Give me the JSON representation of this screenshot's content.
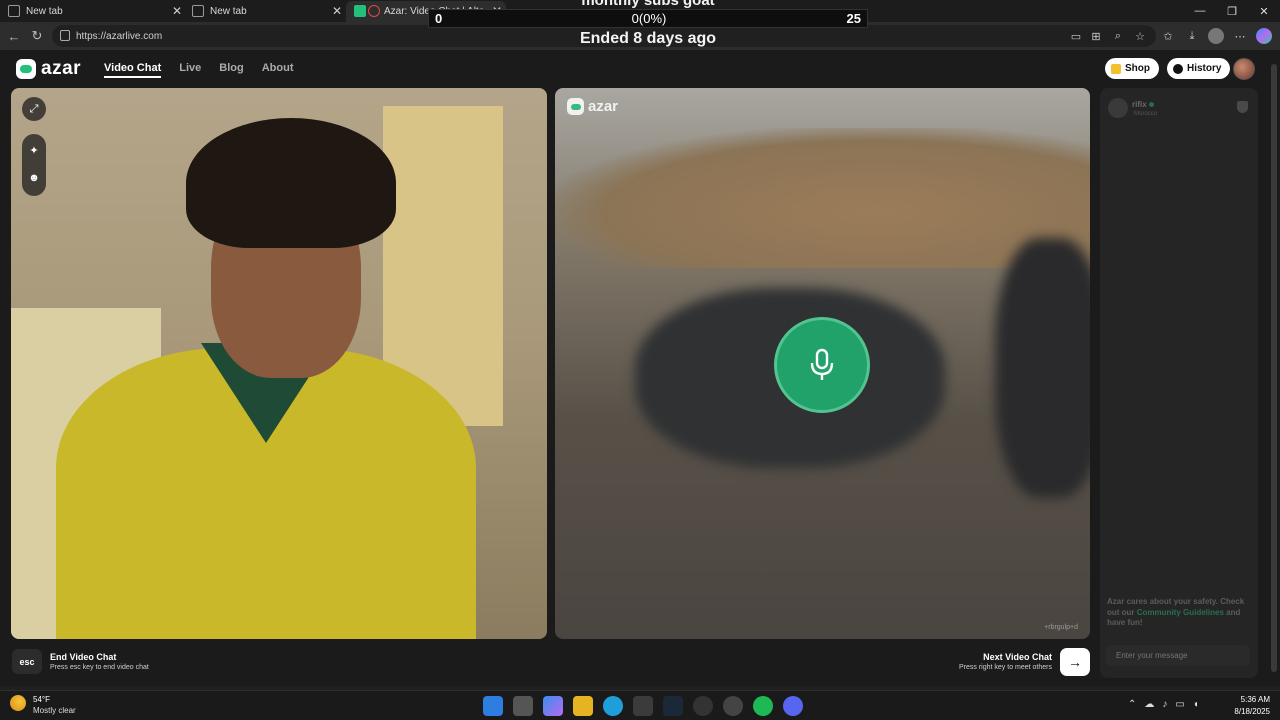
{
  "browser": {
    "tabs": [
      {
        "label": "New tab",
        "active": false
      },
      {
        "label": "New tab",
        "active": false
      },
      {
        "label": "Azar: Video Chat | Alternativ",
        "active": true
      }
    ],
    "url": "https://azarlive.com"
  },
  "overlay": {
    "title": "monthly subs goat",
    "left": "0",
    "center": "0(0%)",
    "right": "25",
    "status": "Ended 8 days ago"
  },
  "app": {
    "brand": "azar",
    "nav": [
      "Video Chat",
      "Live",
      "Blog",
      "About"
    ],
    "shop": "Shop",
    "history": "History"
  },
  "partner": {
    "name": "rifix",
    "location": "Morocco",
    "watermark": "+rbrgulp+d"
  },
  "chat": {
    "safety_text": "Azar cares about your safety. Check out our ",
    "safety_link": "Community Guidelines",
    "safety_end": " and have fun!",
    "placeholder": "Enter your message"
  },
  "controls": {
    "esc_key": "esc",
    "end_title": "End Video Chat",
    "end_sub": "Press esc key to end video chat",
    "next_title": "Next Video Chat",
    "next_sub": "Press right key to meet others",
    "next_arrow": "→"
  },
  "taskbar": {
    "temp": "54°F",
    "weather": "Mostly clear",
    "time": "5:36 AM",
    "date": "8/18/2025"
  }
}
